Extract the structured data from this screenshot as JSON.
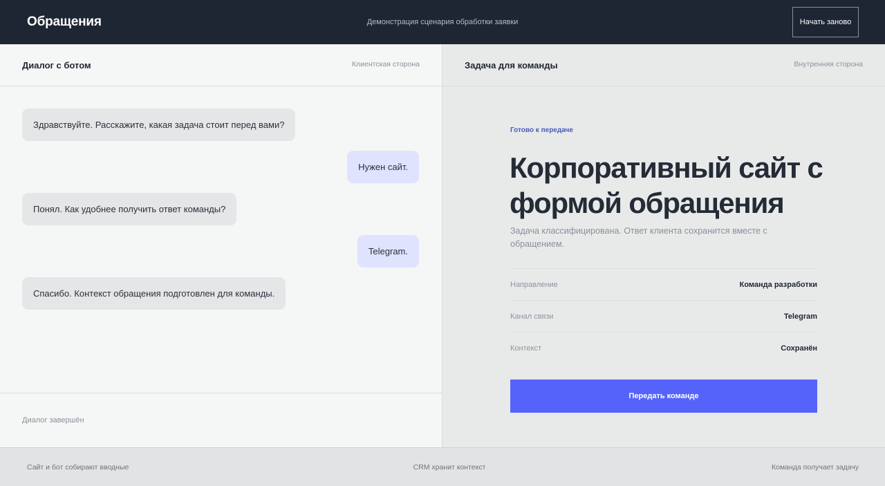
{
  "header": {
    "title": "Обращения",
    "subtitle": "Демонстрация сценария обработки заявки",
    "restart_label": "Начать заново"
  },
  "chat": {
    "title": "Диалог с ботом",
    "tag": "Клиентская сторона",
    "messages": [
      {
        "sender": "bot",
        "text": "Здравствуйте. Расскажите, какая задача стоит перед вами?"
      },
      {
        "sender": "user",
        "text": "Нужен сайт."
      },
      {
        "sender": "bot",
        "text": "Понял. Как удобнее получить ответ команды?"
      },
      {
        "sender": "user",
        "text": "Telegram."
      },
      {
        "sender": "bot",
        "text": "Спасибо. Контекст обращения подготовлен для команды."
      }
    ],
    "status": "Диалог завершён"
  },
  "task": {
    "title": "Задача для команды",
    "tag": "Внутренняя сторона",
    "ready_label": "Готово к передаче",
    "headline": "Корпоративный сайт с формой обращения",
    "description": "Задача классифицирована. Ответ клиента сохранится вместе с обращением.",
    "details": [
      {
        "label": "Направление",
        "value": "Команда разработки"
      },
      {
        "label": "Канал связи",
        "value": "Telegram"
      },
      {
        "label": "Контекст",
        "value": "Сохранён"
      }
    ],
    "send_label": "Передать команде"
  },
  "footer": {
    "steps": [
      "Сайт и бот собирают вводные",
      "CRM хранит контекст",
      "Команда получает задачу"
    ]
  },
  "colors": {
    "topbar": "#1f2633",
    "accent": "#5563fa",
    "user_bubble": "#dfe3fe",
    "bot_bubble": "#e4e6e7"
  }
}
